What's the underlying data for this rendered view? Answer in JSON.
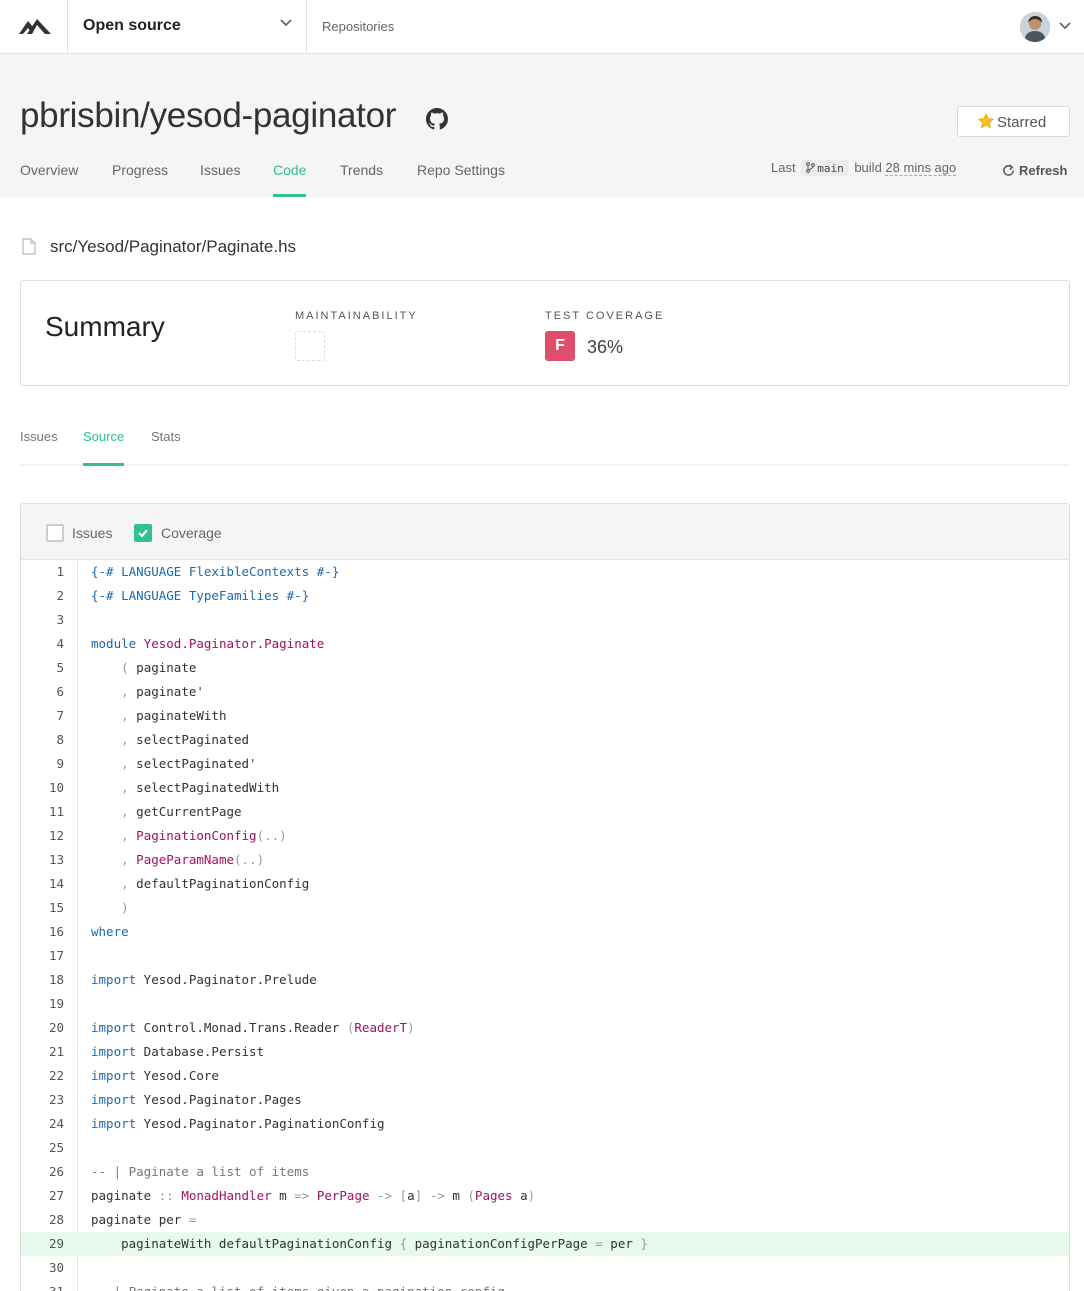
{
  "topbar": {
    "org": "Open source",
    "repositories_link": "Repositories"
  },
  "repo": {
    "title": "pbrisbin/yesod-paginator",
    "star_label": "Starred",
    "tabs": [
      {
        "label": "Overview"
      },
      {
        "label": "Progress"
      },
      {
        "label": "Issues"
      },
      {
        "label": "Code",
        "active": true
      },
      {
        "label": "Trends"
      },
      {
        "label": "Repo Settings"
      }
    ],
    "build": {
      "prefix": "Last",
      "branch": "main",
      "middle": "build",
      "ago": "28 mins ago"
    },
    "refresh_label": "Refresh"
  },
  "file": {
    "path": "src/Yesod/Paginator/Paginate.hs"
  },
  "summary": {
    "title": "Summary",
    "maintainability_label": "MAINTAINABILITY",
    "coverage_label": "TEST COVERAGE",
    "coverage_grade": "F",
    "coverage_value": "36%",
    "grade_color": "#df4e6d"
  },
  "sub_tabs": [
    {
      "label": "Issues"
    },
    {
      "label": "Source",
      "active": true
    },
    {
      "label": "Stats"
    }
  ],
  "toggles": {
    "issues_label": "Issues",
    "issues_checked": false,
    "coverage_label": "Coverage",
    "coverage_checked": true
  },
  "code": {
    "covered_lines": [
      29
    ],
    "lines": [
      "{-# LANGUAGE FlexibleContexts #-}",
      "{-# LANGUAGE TypeFamilies #-}",
      "",
      "module Yesod.Paginator.Paginate",
      "    ( paginate",
      "    , paginate'",
      "    , paginateWith",
      "    , selectPaginated",
      "    , selectPaginated'",
      "    , selectPaginatedWith",
      "    , getCurrentPage",
      "    , PaginationConfig(..)",
      "    , PageParamName(..)",
      "    , defaultPaginationConfig",
      "    )",
      "where",
      "",
      "import Yesod.Paginator.Prelude",
      "",
      "import Control.Monad.Trans.Reader (ReaderT)",
      "import Database.Persist",
      "import Yesod.Core",
      "import Yesod.Paginator.Pages",
      "import Yesod.Paginator.PaginationConfig",
      "",
      "-- | Paginate a list of items",
      "paginate :: MonadHandler m => PerPage -> [a] -> m (Pages a)",
      "paginate per =",
      "    paginateWith defaultPaginationConfig { paginationConfigPerPage = per }",
      "",
      "-- | Paginate a list of items given a pagination config"
    ]
  }
}
